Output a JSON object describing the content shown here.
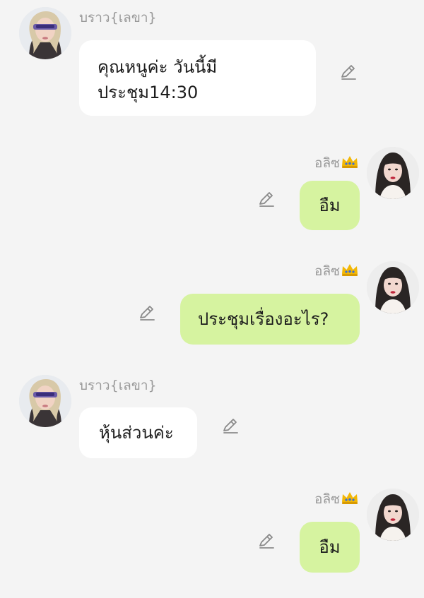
{
  "messages": [
    {
      "sender": "บราว{เลขา}",
      "side": "left",
      "text": "คุณหนูค่ะ วันนี้มีประชุม14:30",
      "edit_icon": "pencil-icon"
    },
    {
      "sender": "อลิซ",
      "sender_badge_icon": "crown-icon",
      "side": "right",
      "text": "อืม",
      "edit_icon": "pencil-icon"
    },
    {
      "sender": "อลิซ",
      "sender_badge_icon": "crown-icon",
      "side": "right",
      "text": "ประชุมเรื่องอะไร?",
      "edit_icon": "pencil-icon"
    },
    {
      "sender": "บราว{เลขา}",
      "side": "left",
      "text": "หุ้นส่วนค่ะ",
      "edit_icon": "pencil-icon"
    },
    {
      "sender": "อลิซ",
      "sender_badge_icon": "crown-icon",
      "side": "right",
      "text": "อืม",
      "edit_icon": "pencil-icon"
    }
  ],
  "colors": {
    "background": "#f4f4f4",
    "left_bubble": "#ffffff",
    "right_bubble": "#d6f3a0",
    "name_text": "#999999",
    "message_text": "#1d1d1d",
    "icon": "#8a8a8a",
    "crown": "#f2b705"
  }
}
